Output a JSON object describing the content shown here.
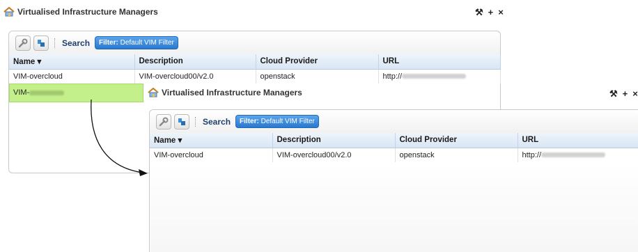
{
  "back": {
    "title": "Virtualised Infrastructure Managers",
    "search_label": "Search",
    "filter_prefix": "Filter:",
    "filter_value": "Default VIM Filter",
    "columns": [
      "Name ▾",
      "Description",
      "Cloud Provider",
      "URL"
    ],
    "rows": [
      {
        "name": "VIM-overcloud",
        "description": "VIM-overcloud00/v2.0",
        "provider": "openstack",
        "url_prefix": "http://"
      }
    ],
    "selected_row_prefix": "VIM-"
  },
  "front": {
    "title": "Virtualised Infrastructure Managers",
    "search_label": "Search",
    "filter_prefix": "Filter:",
    "filter_value": "Default VIM Filter",
    "columns": [
      "Name ▾",
      "Description",
      "Cloud Provider",
      "URL"
    ],
    "rows": [
      {
        "name": "VIM-overcloud",
        "description": "VIM-overcloud00/v2.0",
        "provider": "openstack",
        "url_prefix": "http://"
      }
    ]
  },
  "window_controls": {
    "wrench": "🔧",
    "plus": "+",
    "close": "×"
  },
  "icons": [
    "home-icon",
    "wrench-icon",
    "refresh-icon",
    "arrow-icon"
  ],
  "colors": {
    "selected_row": "#c3f08a",
    "filter_button": "#2a78cf",
    "header_bg": "#d9e6f4"
  }
}
